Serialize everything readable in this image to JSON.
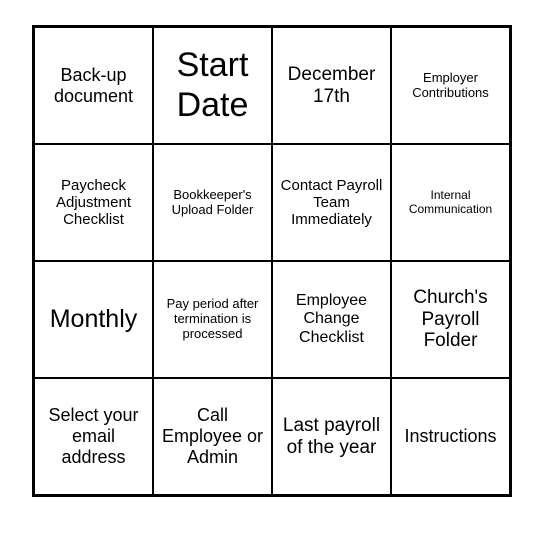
{
  "grid": {
    "cells": [
      {
        "text": "Back-up document"
      },
      {
        "text": "Start Date"
      },
      {
        "text": "December 17th"
      },
      {
        "text": "Employer Contributions"
      },
      {
        "text": "Paycheck Adjustment Checklist"
      },
      {
        "text": "Bookkeeper's Upload Folder"
      },
      {
        "text": "Contact Payroll Team Immediately"
      },
      {
        "text": "Internal Communication"
      },
      {
        "text": "Monthly"
      },
      {
        "text": "Pay period after termination is processed"
      },
      {
        "text": "Employee Change Checklist"
      },
      {
        "text": "Church's Payroll Folder"
      },
      {
        "text": "Select your email address"
      },
      {
        "text": "Call Employee or Admin"
      },
      {
        "text": "Last payroll of the year"
      },
      {
        "text": "Instructions"
      }
    ]
  }
}
